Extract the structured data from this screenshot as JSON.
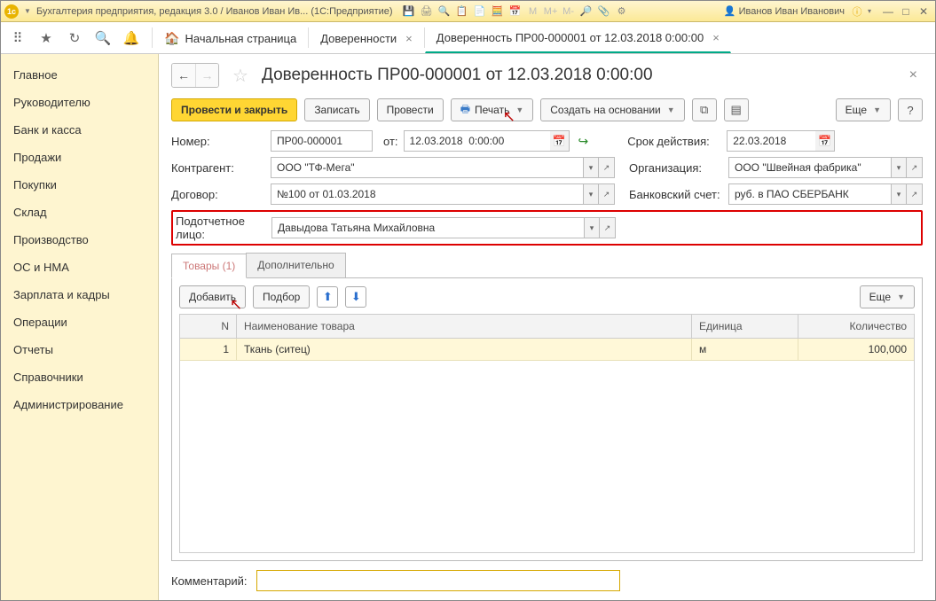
{
  "titlebar": {
    "logo_text": "1c",
    "title": "Бухгалтерия предприятия, редакция 3.0 / Иванов Иван Ив...   (1С:Предприятие)",
    "user": "Иванов Иван Иванович"
  },
  "tabsbar": {
    "home": "Начальная страница",
    "tab1": "Доверенности",
    "tab2": "Доверенность ПР00-000001 от 12.03.2018 0:00:00"
  },
  "sidebar": {
    "items": [
      "Главное",
      "Руководителю",
      "Банк и касса",
      "Продажи",
      "Покупки",
      "Склад",
      "Производство",
      "ОС и НМА",
      "Зарплата и кадры",
      "Операции",
      "Отчеты",
      "Справочники",
      "Администрирование"
    ]
  },
  "header": {
    "title": "Доверенность ПР00-000001 от 12.03.2018 0:00:00"
  },
  "cmd": {
    "primary": "Провести и закрыть",
    "save": "Записать",
    "run": "Провести",
    "print": "Печать",
    "based": "Создать на основании",
    "more": "Еще",
    "help": "?"
  },
  "form": {
    "number_label": "Номер:",
    "number": "ПР00-000001",
    "from_label": "от:",
    "date": "12.03.2018  0:00:00",
    "validity_label": "Срок действия:",
    "validity": "22.03.2018",
    "counterparty_label": "Контрагент:",
    "counterparty": "ООО \"ТФ-Мега\"",
    "org_label": "Организация:",
    "org": "ООО \"Швейная фабрика\"",
    "contract_label": "Договор:",
    "contract": "№100 от 01.03.2018",
    "bank_label": "Банковский счет:",
    "bank": "руб. в ПАО СБЕРБАНК",
    "person_label": "Подотчетное лицо:",
    "person": "Давыдова Татьяна Михайловна"
  },
  "tabs": {
    "goods": "Товары (1)",
    "extra": "Дополнительно"
  },
  "panel": {
    "add": "Добавить",
    "pick": "Подбор",
    "more": "Еще"
  },
  "table": {
    "col_n": "N",
    "col_name": "Наименование товара",
    "col_unit": "Единица",
    "col_qty": "Количество",
    "rows": [
      {
        "n": "1",
        "name": "Ткань (ситец)",
        "unit": "м",
        "qty": "100,000"
      }
    ]
  },
  "comment": {
    "label": "Комментарий:",
    "value": ""
  }
}
